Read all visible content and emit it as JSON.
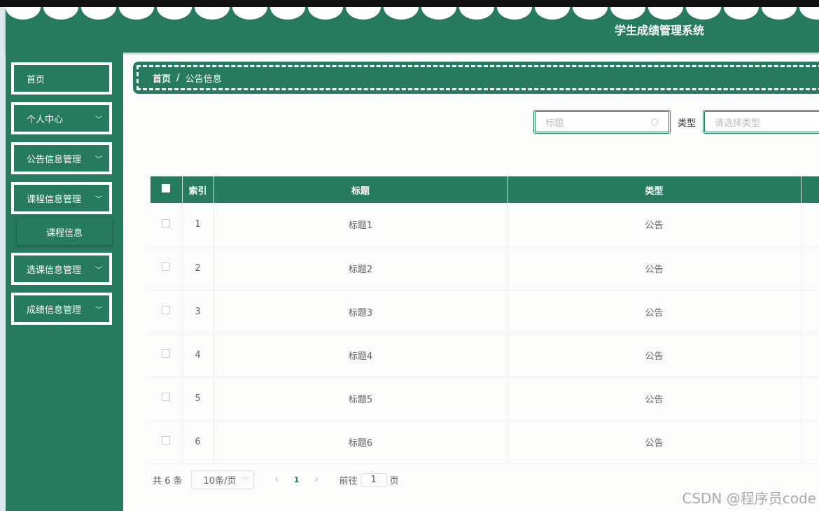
{
  "header": {
    "title": "学生成绩管理系统"
  },
  "sidebar": {
    "items": [
      {
        "label": "首页"
      },
      {
        "label": "个人中心"
      },
      {
        "label": "公告信息管理"
      },
      {
        "label": "课程信息管理"
      },
      {
        "label": "选课信息管理"
      },
      {
        "label": "成绩信息管理"
      }
    ],
    "submenu": "课程信息"
  },
  "breadcrumb": {
    "home": "首页",
    "sep": "/",
    "current": "公告信息"
  },
  "filters": {
    "title_placeholder": "标题",
    "type_label": "类型",
    "type_placeholder": "请选择类型"
  },
  "table": {
    "headers": [
      "索引",
      "标题",
      "类型"
    ],
    "rows": [
      [
        "1",
        "标题1",
        "公告"
      ],
      [
        "2",
        "标题2",
        "公告"
      ],
      [
        "3",
        "标题3",
        "公告"
      ],
      [
        "4",
        "标题4",
        "公告"
      ],
      [
        "5",
        "标题5",
        "公告"
      ],
      [
        "6",
        "标题6",
        "公告"
      ]
    ]
  },
  "pager": {
    "total": "共 6 条",
    "size": "10条/页",
    "current": "1",
    "goto": "前往",
    "goto_value": "1",
    "page_suffix": "页"
  },
  "watermark": "CSDN @程序员code"
}
